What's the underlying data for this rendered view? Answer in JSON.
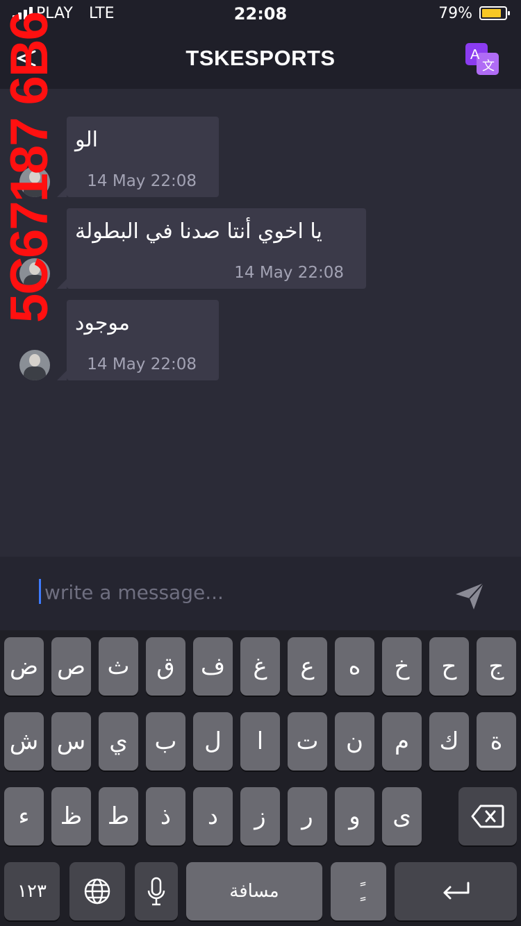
{
  "status_bar": {
    "carrier": "PLAY",
    "network": "LTE",
    "time": "22:08",
    "battery_percent": "79%",
    "battery_level": 0.79,
    "battery_color": "#f8c825"
  },
  "header": {
    "title": "TSKESPORTS",
    "back_icon": "back-arrow-icon",
    "translate_icon": "translate-icon",
    "translate_color": "#8b3cf0"
  },
  "watermark": "5C67187 6B6",
  "messages": [
    {
      "text": "الو",
      "timestamp": "14 May 22:08"
    },
    {
      "text": "يا اخوي أنتا صدنا في البطولة",
      "timestamp": "14 May 22:08"
    },
    {
      "text": "موجود",
      "timestamp": "14 May 22:08"
    }
  ],
  "composer": {
    "placeholder": "write a message...",
    "send_icon": "send-icon"
  },
  "keyboard": {
    "row1": [
      "ض",
      "ص",
      "ث",
      "ق",
      "ف",
      "غ",
      "ع",
      "ه",
      "خ",
      "ح",
      "ج"
    ],
    "row2": [
      "ش",
      "س",
      "ي",
      "ب",
      "ل",
      "ا",
      "ت",
      "ن",
      "م",
      "ك",
      "ة"
    ],
    "row3": [
      "ء",
      "ظ",
      "ط",
      "ذ",
      "د",
      "ز",
      "ر",
      "و",
      "ى"
    ],
    "numbers_key": "١٢٣",
    "space_key": "مسافة",
    "diacritic_key": "ًٍ",
    "globe_icon": "globe-icon",
    "mic_icon": "microphone-icon",
    "backspace_icon": "backspace-icon",
    "return_icon": "return-icon"
  }
}
